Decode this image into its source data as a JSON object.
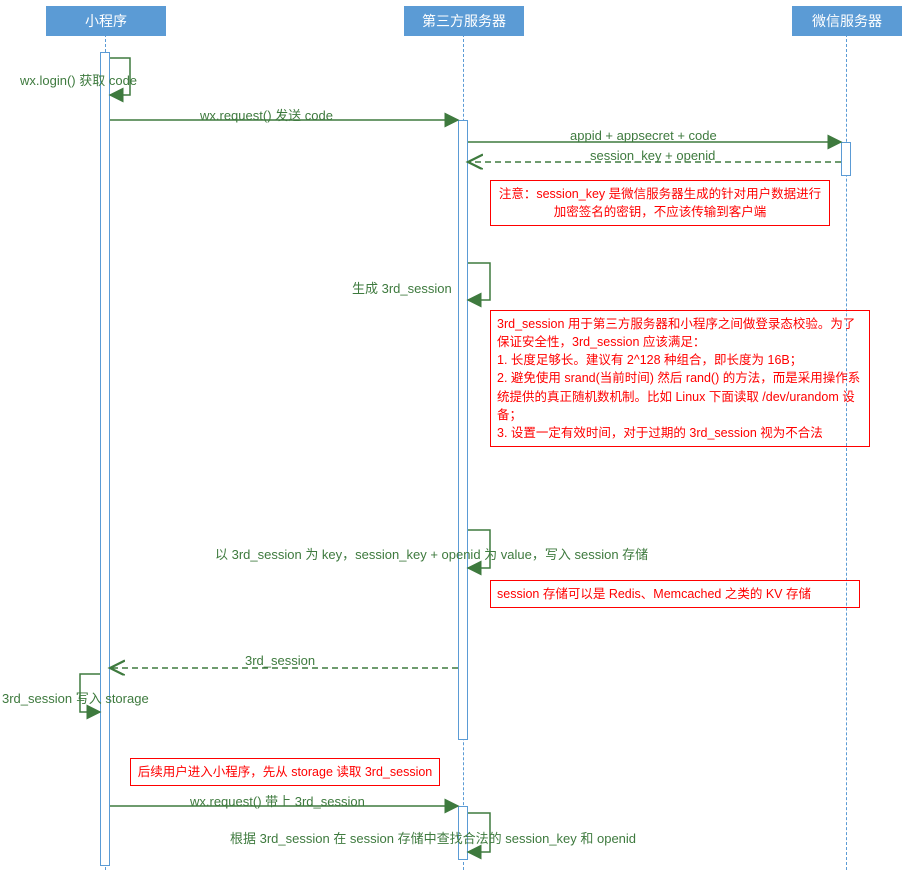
{
  "participants": {
    "miniprogram": "小程序",
    "thirdparty": "第三方服务器",
    "wechat": "微信服务器"
  },
  "messages": {
    "login": "wx.login() 获取 code",
    "send_code": "wx.request() 发送 code",
    "appid": "appid + appsecret + code",
    "session_openid": "session_key + openid",
    "gen_3rd": "生成 3rd_session",
    "write_session": "以 3rd_session 为 key，session_key + openid 为 value，写入 session 存储",
    "return_3rd": "3rd_session",
    "write_storage": "3rd_session 写入 storage",
    "send_3rd": "wx.request() 带上 3rd_session",
    "lookup": "根据 3rd_session 在 session 存储中查找合法的 session_key 和 openid"
  },
  "notes": {
    "n1": "注意：session_key 是微信服务器生成的针对用户数据进行加密签名的密钥，不应该传输到客户端",
    "n2": "3rd_session 用于第三方服务器和小程序之间做登录态校验。为了保证安全性，3rd_session 应该满足：\n1. 长度足够长。建议有 2^128 种组合，即长度为 16B；\n2. 避免使用 srand(当前时间) 然后 rand() 的方法，而是采用操作系统提供的真正随机数机制。比如 Linux 下面读取 /dev/urandom 设备；\n3. 设置一定有效时间，对于过期的 3rd_session 视为不合法",
    "n3": "session 存储可以是 Redis、Memcached 之类的 KV 存储",
    "n4": "后续用户进入小程序，先从 storage 读取 3rd_session"
  },
  "colors": {
    "header_bg": "#5b9bd5",
    "line": "#3e7a3e",
    "note_border": "#ff0000"
  }
}
